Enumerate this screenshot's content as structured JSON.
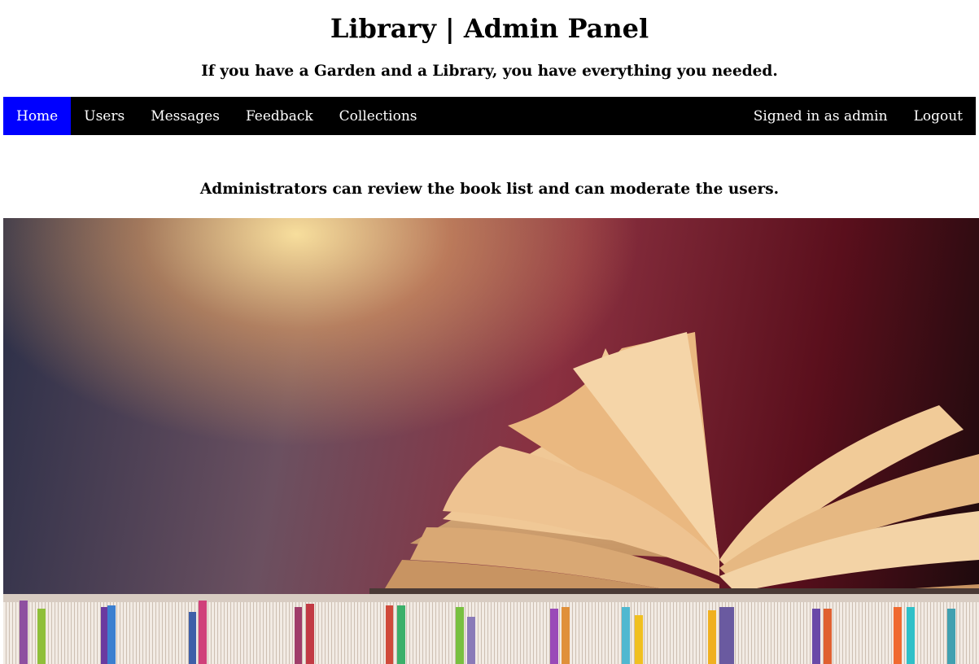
{
  "header": {
    "title": "Library | Admin Panel",
    "tagline": "If you have a Garden and a Library, you have everything you needed."
  },
  "nav": {
    "left_items": [
      {
        "label": "Home",
        "active": true
      },
      {
        "label": "Users",
        "active": false
      },
      {
        "label": "Messages",
        "active": false
      },
      {
        "label": "Feedback",
        "active": false
      },
      {
        "label": "Collections",
        "active": false
      }
    ],
    "signed_in_text": "Signed in as admin",
    "logout_label": "Logout"
  },
  "main": {
    "intro": "Administrators can review the book list and can moderate the users."
  },
  "colors": {
    "nav_background": "#000000",
    "nav_active": "#0000ff",
    "nav_text": "#ffffff"
  }
}
